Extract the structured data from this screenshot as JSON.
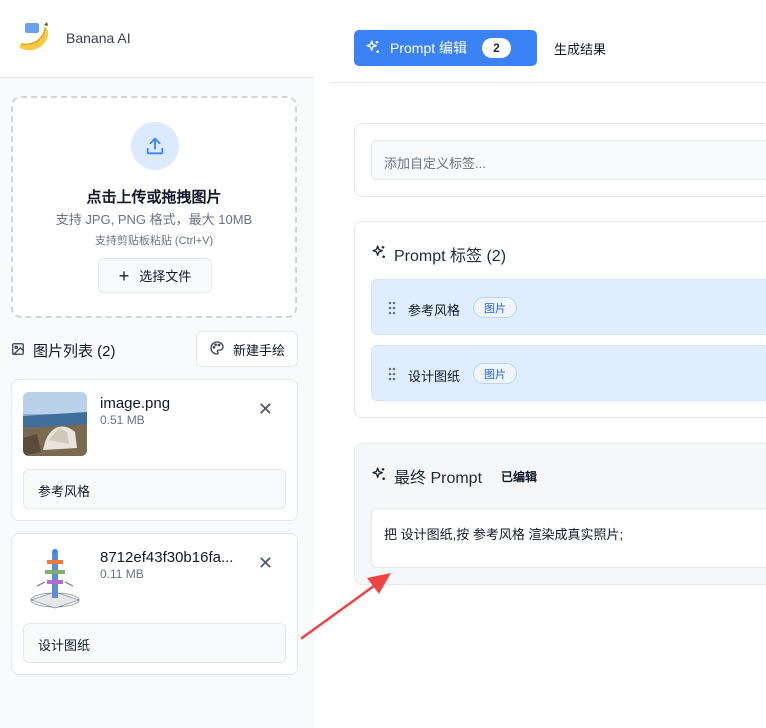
{
  "brand": {
    "name": "Banana AI"
  },
  "upload": {
    "title": "点击上传或拖拽图片",
    "subtitle": "支持 JPG, PNG 格式，最大 10MB",
    "hint": "支持剪贴板粘贴 (Ctrl+V)",
    "choose_label": "选择文件"
  },
  "image_list": {
    "title": "图片列表 (2)",
    "new_sketch_label": "新建手绘",
    "items": [
      {
        "name": "image.png",
        "size": "0.51 MB",
        "tag": "参考风格"
      },
      {
        "name": "8712ef43f30b16fa...",
        "size": "0.11 MB",
        "tag": "设计图纸"
      }
    ]
  },
  "tabs": {
    "prompt_edit_label": "Prompt 编辑",
    "prompt_edit_count": "2",
    "results_label": "生成结果"
  },
  "custom_tag": {
    "placeholder": "添加自定义标签..."
  },
  "prompt_tags": {
    "title": "Prompt 标签 (2)",
    "items": [
      {
        "label": "参考风格",
        "badge": "图片"
      },
      {
        "label": "设计图纸",
        "badge": "图片"
      }
    ]
  },
  "final_prompt": {
    "title": "最终 Prompt",
    "status": "已编辑",
    "text": "把 设计图纸,按 参考风格 渲染成真实照片;"
  },
  "colors": {
    "accent": "#3b82f6",
    "annotation_arrow": "#ef4444"
  }
}
